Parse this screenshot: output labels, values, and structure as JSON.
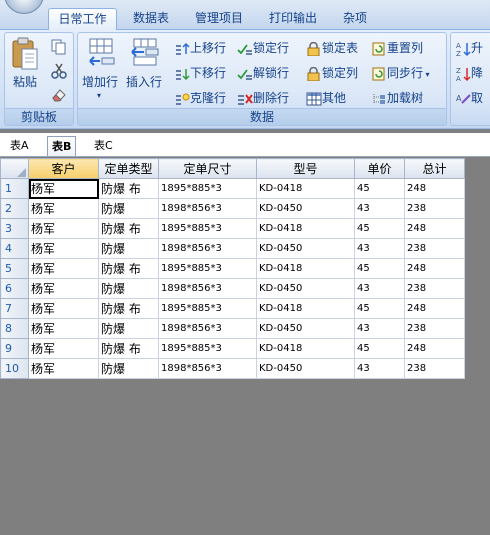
{
  "tabs": [
    "日常工作",
    "数据表",
    "管理项目",
    "打印输出",
    "杂项"
  ],
  "active_tab": 0,
  "clipboard": {
    "paste_label": "粘贴",
    "group_label": "剪贴板"
  },
  "data_group": {
    "add_row_label": "增加行",
    "insert_row_label": "插入行",
    "move_up": "上移行",
    "move_down": "下移行",
    "clone_row": "克隆行",
    "lock_row": "锁定行",
    "unlock_row": "解锁行",
    "delete_row": "删除行",
    "lock_table": "锁定表",
    "lock_column": "锁定列",
    "other": "其他",
    "reset_column": "重置列",
    "sync_row": "同步行",
    "load_tree": "加载树",
    "group_label": "数据"
  },
  "sort_group": {
    "asc": "升",
    "desc": "降",
    "cancel": "取"
  },
  "sheets": [
    "表A",
    "表B",
    "表C"
  ],
  "active_sheet": 1,
  "columns": [
    "客户",
    "定单类型",
    "定单尺寸",
    "型号",
    "单价",
    "总计"
  ],
  "rows": [
    [
      "1",
      "杨军",
      "防爆 布",
      "1895*885*3",
      "KD-0418",
      "45",
      "248"
    ],
    [
      "2",
      "杨军",
      "防爆",
      "1898*856*3",
      "KD-0450",
      "43",
      "238"
    ],
    [
      "3",
      "杨军",
      "防爆 布",
      "1895*885*3",
      "KD-0418",
      "45",
      "248"
    ],
    [
      "4",
      "杨军",
      "防爆",
      "1898*856*3",
      "KD-0450",
      "43",
      "238"
    ],
    [
      "5",
      "杨军",
      "防爆 布",
      "1895*885*3",
      "KD-0418",
      "45",
      "248"
    ],
    [
      "6",
      "杨军",
      "防爆",
      "1898*856*3",
      "KD-0450",
      "43",
      "238"
    ],
    [
      "7",
      "杨军",
      "防爆 布",
      "1895*885*3",
      "KD-0418",
      "45",
      "248"
    ],
    [
      "8",
      "杨军",
      "防爆",
      "1898*856*3",
      "KD-0450",
      "43",
      "238"
    ],
    [
      "9",
      "杨军",
      "防爆 布",
      "1895*885*3",
      "KD-0418",
      "45",
      "248"
    ],
    [
      "10",
      "杨军",
      "防爆",
      "1898*856*3",
      "KD-0450",
      "43",
      "238"
    ]
  ],
  "colors": {
    "ribbon_text": "#15428b",
    "row_header_text": "#1e5bb0",
    "workspace": "#7f7f7f"
  }
}
